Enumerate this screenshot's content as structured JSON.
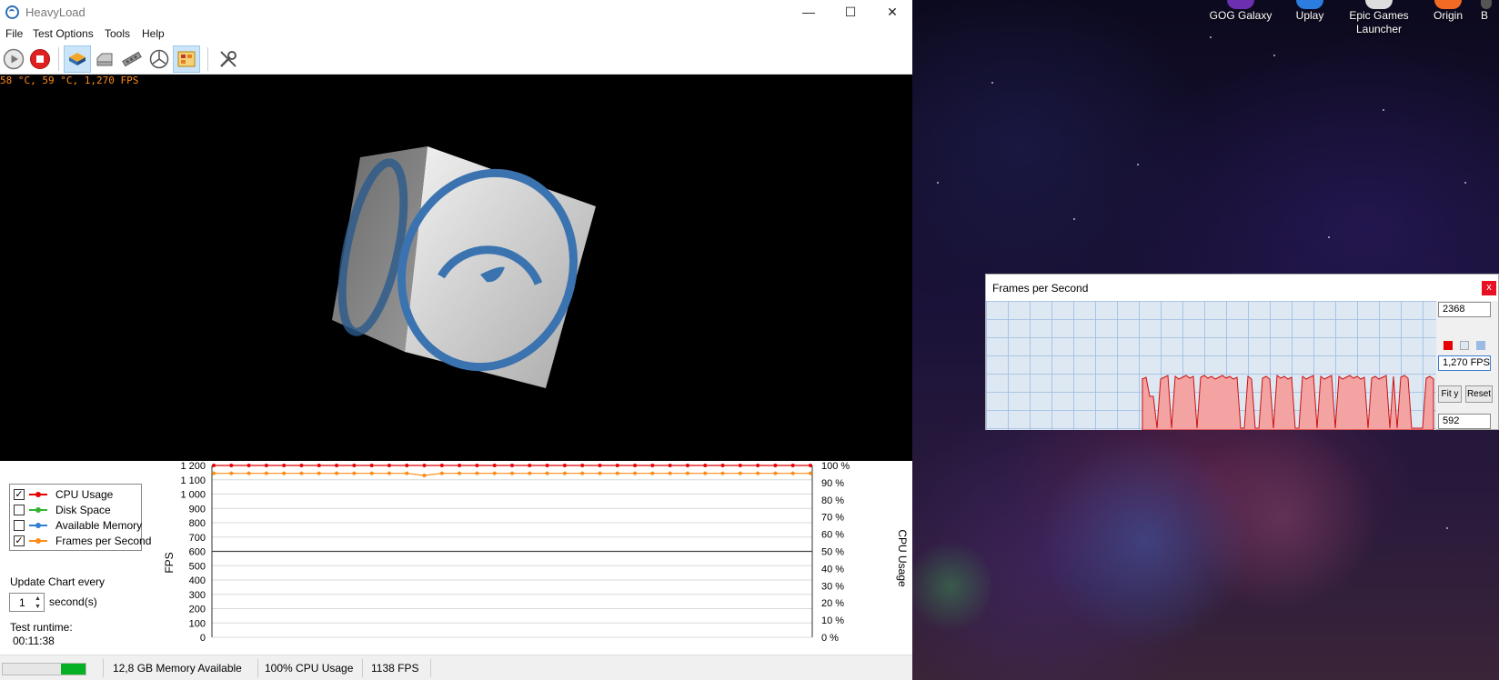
{
  "window": {
    "title": "HeavyLoad",
    "controls": {
      "minimize": "—",
      "maximize": "☐",
      "close": "✕"
    }
  },
  "menu": {
    "items": [
      "File",
      "Test Options",
      "Tools",
      "Help"
    ]
  },
  "toolbar": {
    "buttons": [
      {
        "name": "start-icon",
        "active": false
      },
      {
        "name": "stop-icon",
        "active": false
      },
      {
        "name": "cpu-load-icon",
        "active": true
      },
      {
        "name": "disk-load-icon",
        "active": false
      },
      {
        "name": "memory-load-icon",
        "active": false
      },
      {
        "name": "gpu-load-icon",
        "active": false
      },
      {
        "name": "chart-icon",
        "active": true
      },
      {
        "name": "tools-icon",
        "active": false
      }
    ]
  },
  "viewport": {
    "overlay": "58 °C, 59 °C, 1,270 FPS"
  },
  "legend": {
    "items": [
      {
        "label": "CPU Usage",
        "checked": true,
        "color": "#e60000"
      },
      {
        "label": "Disk Space",
        "checked": false,
        "color": "#33b533"
      },
      {
        "label": "Available Memory",
        "checked": false,
        "color": "#2f7fd0"
      },
      {
        "label": "Frames per Second",
        "checked": true,
        "color": "#ff8c1a"
      }
    ]
  },
  "update": {
    "label": "Update Chart every",
    "value": "1",
    "unit": "second(s)"
  },
  "runtime": {
    "label": "Test runtime:",
    "value": "00:11:38"
  },
  "chart_data": {
    "type": "line",
    "left_axis_label": "FPS",
    "right_axis_label": "CPU Usage",
    "left_ticks": [
      "0",
      "100",
      "200",
      "300",
      "400",
      "500",
      "600",
      "700",
      "800",
      "900",
      "1 000",
      "1 100",
      "1 200"
    ],
    "right_ticks": [
      "0 %",
      "10 %",
      "20 %",
      "30 %",
      "40 %",
      "50 %",
      "60 %",
      "70 %",
      "80 %",
      "90 %",
      "100 %"
    ],
    "ylim_left": [
      0,
      1200
    ],
    "ylim_right": [
      0,
      100
    ],
    "series": [
      {
        "name": "CPU Usage",
        "axis": "right",
        "color": "#e60000",
        "values": [
          100,
          100,
          100,
          100,
          100,
          100,
          100,
          100,
          100,
          100,
          100,
          100,
          100,
          100,
          100,
          100,
          100,
          100,
          100,
          100,
          100,
          100,
          100,
          100,
          100,
          100,
          100,
          100,
          100,
          100,
          100,
          100,
          100,
          100,
          100
        ]
      },
      {
        "name": "Frames per Second",
        "axis": "left",
        "color": "#ff8c1a",
        "values": [
          1145,
          1145,
          1145,
          1145,
          1145,
          1145,
          1145,
          1145,
          1145,
          1145,
          1145,
          1145,
          1130,
          1145,
          1145,
          1145,
          1145,
          1145,
          1145,
          1145,
          1145,
          1145,
          1145,
          1145,
          1145,
          1145,
          1145,
          1145,
          1145,
          1145,
          1145,
          1145,
          1145,
          1145,
          1145
        ]
      }
    ]
  },
  "status": {
    "progress": 0.3,
    "memory": "12,8 GB Memory Available",
    "cpu": "100% CPU Usage",
    "fps": "1138 FPS"
  },
  "fps_monitor": {
    "title": "Frames per Second",
    "close": "x",
    "max": "2368",
    "current": "1,270 FPS",
    "min": "592",
    "fit_label": "Fit y",
    "reset_label": "Reset",
    "swatches": [
      "#e60000",
      "#dde8f2",
      "#9bbbe3"
    ]
  },
  "desktop_icons": [
    "GOG Galaxy",
    "Uplay",
    "Epic Games Launcher",
    "Origin",
    "B"
  ]
}
